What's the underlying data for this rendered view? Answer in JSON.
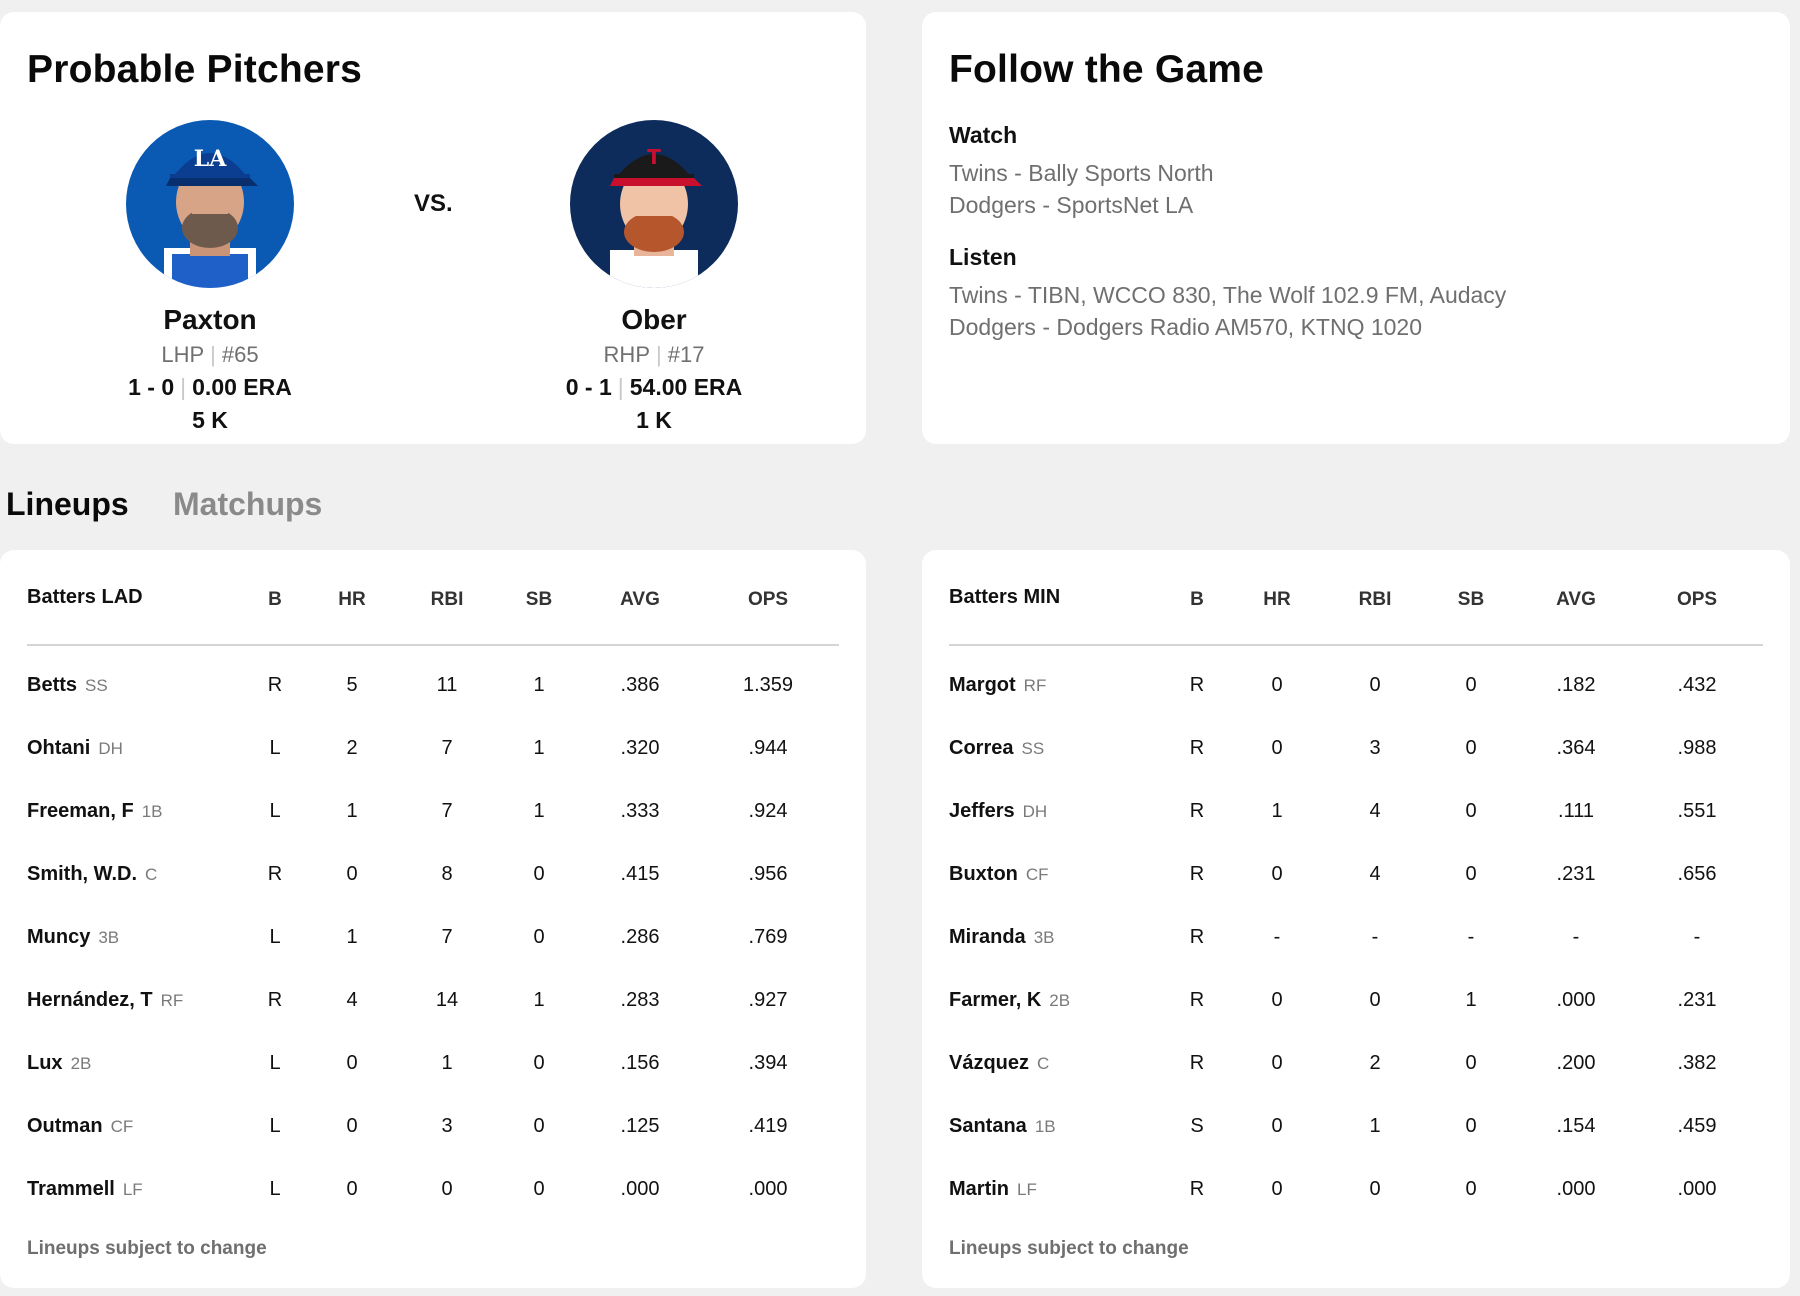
{
  "pitchers": {
    "title": "Probable Pitchers",
    "vs": "VS.",
    "away": {
      "name": "Paxton",
      "hand": "LHP",
      "number": "#65",
      "record": "1 - 0",
      "era": "0.00 ERA",
      "k": "5 K",
      "team_color": "#005A9C"
    },
    "home": {
      "name": "Ober",
      "hand": "RHP",
      "number": "#17",
      "record": "0 - 1",
      "era": "54.00 ERA",
      "k": "1 K",
      "team_color": "#002B5C"
    }
  },
  "follow": {
    "title": "Follow the Game",
    "watch_label": "Watch",
    "watch": [
      "Twins - Bally Sports North",
      "Dodgers - SportsNet LA"
    ],
    "listen_label": "Listen",
    "listen": [
      "Twins - TIBN, WCCO 830, The Wolf 102.9 FM, Audacy",
      "Dodgers - Dodgers Radio AM570, KTNQ 1020"
    ]
  },
  "tabs": {
    "lineups": "Lineups",
    "matchups": "Matchups"
  },
  "columns": [
    "B",
    "HR",
    "RBI",
    "SB",
    "AVG",
    "OPS"
  ],
  "lad": {
    "header": "Batters LAD",
    "footnote": "Lineups subject to change",
    "rows": [
      {
        "name": "Betts",
        "pos": "SS",
        "b": "R",
        "hr": "5",
        "rbi": "11",
        "sb": "1",
        "avg": ".386",
        "ops": "1.359"
      },
      {
        "name": "Ohtani",
        "pos": "DH",
        "b": "L",
        "hr": "2",
        "rbi": "7",
        "sb": "1",
        "avg": ".320",
        "ops": ".944"
      },
      {
        "name": "Freeman, F",
        "pos": "1B",
        "b": "L",
        "hr": "1",
        "rbi": "7",
        "sb": "1",
        "avg": ".333",
        "ops": ".924"
      },
      {
        "name": "Smith, W.D.",
        "pos": "C",
        "b": "R",
        "hr": "0",
        "rbi": "8",
        "sb": "0",
        "avg": ".415",
        "ops": ".956"
      },
      {
        "name": "Muncy",
        "pos": "3B",
        "b": "L",
        "hr": "1",
        "rbi": "7",
        "sb": "0",
        "avg": ".286",
        "ops": ".769"
      },
      {
        "name": "Hernández, T",
        "pos": "RF",
        "b": "R",
        "hr": "4",
        "rbi": "14",
        "sb": "1",
        "avg": ".283",
        "ops": ".927"
      },
      {
        "name": "Lux",
        "pos": "2B",
        "b": "L",
        "hr": "0",
        "rbi": "1",
        "sb": "0",
        "avg": ".156",
        "ops": ".394"
      },
      {
        "name": "Outman",
        "pos": "CF",
        "b": "L",
        "hr": "0",
        "rbi": "3",
        "sb": "0",
        "avg": ".125",
        "ops": ".419"
      },
      {
        "name": "Trammell",
        "pos": "LF",
        "b": "L",
        "hr": "0",
        "rbi": "0",
        "sb": "0",
        "avg": ".000",
        "ops": ".000"
      }
    ]
  },
  "min": {
    "header": "Batters MIN",
    "footnote": "Lineups subject to change",
    "rows": [
      {
        "name": "Margot",
        "pos": "RF",
        "b": "R",
        "hr": "0",
        "rbi": "0",
        "sb": "0",
        "avg": ".182",
        "ops": ".432"
      },
      {
        "name": "Correa",
        "pos": "SS",
        "b": "R",
        "hr": "0",
        "rbi": "3",
        "sb": "0",
        "avg": ".364",
        "ops": ".988"
      },
      {
        "name": "Jeffers",
        "pos": "DH",
        "b": "R",
        "hr": "1",
        "rbi": "4",
        "sb": "0",
        "avg": ".111",
        "ops": ".551"
      },
      {
        "name": "Buxton",
        "pos": "CF",
        "b": "R",
        "hr": "0",
        "rbi": "4",
        "sb": "0",
        "avg": ".231",
        "ops": ".656"
      },
      {
        "name": "Miranda",
        "pos": "3B",
        "b": "R",
        "hr": "-",
        "rbi": "-",
        "sb": "-",
        "avg": "-",
        "ops": "-"
      },
      {
        "name": "Farmer, K",
        "pos": "2B",
        "b": "R",
        "hr": "0",
        "rbi": "0",
        "sb": "1",
        "avg": ".000",
        "ops": ".231"
      },
      {
        "name": "Vázquez",
        "pos": "C",
        "b": "R",
        "hr": "0",
        "rbi": "2",
        "sb": "0",
        "avg": ".200",
        "ops": ".382"
      },
      {
        "name": "Santana",
        "pos": "1B",
        "b": "S",
        "hr": "0",
        "rbi": "1",
        "sb": "0",
        "avg": ".154",
        "ops": ".459"
      },
      {
        "name": "Martin",
        "pos": "LF",
        "b": "R",
        "hr": "0",
        "rbi": "0",
        "sb": "0",
        "avg": ".000",
        "ops": ".000"
      }
    ]
  }
}
